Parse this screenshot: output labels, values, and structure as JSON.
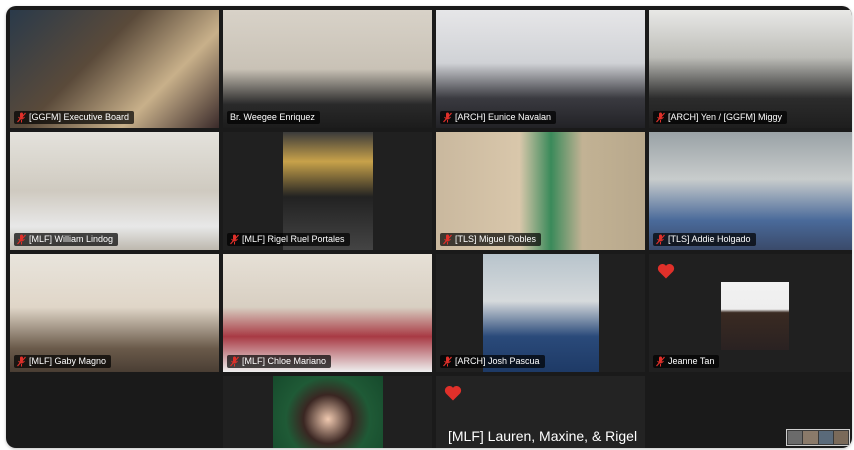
{
  "meeting": {
    "participants": [
      {
        "name": "[GGFM] Executive Board"
      },
      {
        "name": "Br. Weegee Enriquez"
      },
      {
        "name": "[ARCH] Eunice Navalan"
      },
      {
        "name": "[ARCH] Yen / [GGFM] Miggy"
      },
      {
        "name": "[MLF] William Lindog"
      },
      {
        "name": "[MLF] Rigel Ruel Portales"
      },
      {
        "name": "[TLS] Miguel Robles"
      },
      {
        "name": "[TLS] Addie Holgado"
      },
      {
        "name": "[MLF] Gaby Magno"
      },
      {
        "name": "[MLF] Chloe Mariano"
      },
      {
        "name": "[ARCH] Josh Pascua"
      },
      {
        "name": "Jeanne Tan"
      }
    ],
    "camera_off_tile": {
      "name": "[MLF] Lauren, Maxine, & Rigel"
    },
    "active_speaker_color": "#2fcf62",
    "muted_icon": "microphone-muted-icon",
    "heart_icon": "heart-icon",
    "heart_color": "#e0302a"
  }
}
